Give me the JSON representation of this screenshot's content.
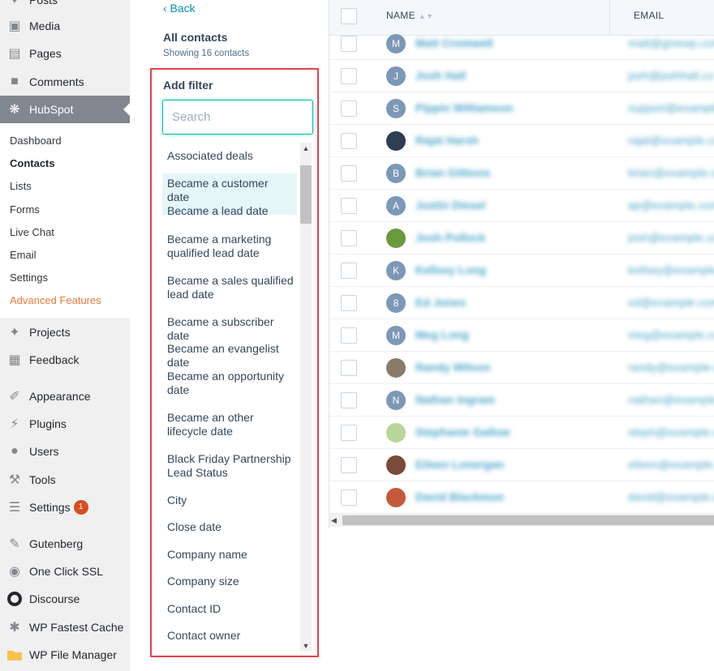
{
  "wp_sidebar": {
    "items": [
      {
        "label": "Posts"
      },
      {
        "label": "Media"
      },
      {
        "label": "Pages"
      },
      {
        "label": "Comments"
      },
      {
        "label": "HubSpot"
      },
      {
        "label": "Projects"
      },
      {
        "label": "Feedback"
      },
      {
        "label": "Appearance"
      },
      {
        "label": "Plugins"
      },
      {
        "label": "Users"
      },
      {
        "label": "Tools"
      },
      {
        "label": "Settings"
      },
      {
        "label": "Gutenberg"
      },
      {
        "label": "One Click SSL"
      },
      {
        "label": "Discourse"
      },
      {
        "label": "WP Fastest Cache"
      },
      {
        "label": "WP File Manager"
      }
    ],
    "settings_badge": "1",
    "hubspot_submenu": [
      "Dashboard",
      "Contacts",
      "Lists",
      "Forms",
      "Live Chat",
      "Email",
      "Settings",
      "Advanced Features"
    ]
  },
  "panel": {
    "back": "‹ Back",
    "title": "All contacts",
    "subtitle": "Showing 16 contacts",
    "add_filter": "Add filter",
    "search_placeholder": "Search",
    "filters": [
      "Associated deals",
      "Became a customer date",
      "Became a lead date",
      "Became a marketing qualified lead date",
      "Became a sales qualified lead date",
      "Became a subscriber date",
      "Became an evangelist date",
      "Became an opportunity date",
      "Became an other lifecycle date",
      "Black Friday Partnership Lead Status",
      "City",
      "Close date",
      "Company name",
      "Company size",
      "Contact ID",
      "Contact owner"
    ]
  },
  "table": {
    "col_name": "NAME",
    "col_email": "EMAIL",
    "rows": [
      {
        "initial": "M",
        "name": "Matt Cromwell",
        "email": "matt@givewp.com"
      },
      {
        "initial": "J",
        "name": "Josh Hall",
        "email": "josh@joshhall.co"
      },
      {
        "initial": "S",
        "name": "Pippin Williamson",
        "email": "support@example.com"
      },
      {
        "initial": "",
        "name": "Rajat Harsh",
        "email": "rajat@example.com"
      },
      {
        "initial": "B",
        "name": "Brian Gittions",
        "email": "brian@example.com"
      },
      {
        "initial": "A",
        "name": "Justin Diesel",
        "email": "ap@example.com"
      },
      {
        "initial": "",
        "name": "Josh Pollock",
        "email": "josh@example.com"
      },
      {
        "initial": "K",
        "name": "Kellsey Long",
        "email": "kellsey@example.com"
      },
      {
        "initial": "8",
        "name": "Ed Jones",
        "email": "ed@example.com"
      },
      {
        "initial": "M",
        "name": "Meg Long",
        "email": "meg@example.com"
      },
      {
        "initial": "",
        "name": "Randy Wilson",
        "email": "randy@example.com"
      },
      {
        "initial": "N",
        "name": "Nathan Ingram",
        "email": "nathan@example.com"
      },
      {
        "initial": "",
        "name": "Stephanie Gallow",
        "email": "steph@example.com"
      },
      {
        "initial": "",
        "name": "Eileen Lonergan",
        "email": "eileen@example.com"
      },
      {
        "initial": "",
        "name": "David Blackmon",
        "email": "david@example.com"
      }
    ]
  },
  "colors": {
    "accent": "#e5414a",
    "link": "#0091ae",
    "hubspot_active": "#80878e"
  }
}
